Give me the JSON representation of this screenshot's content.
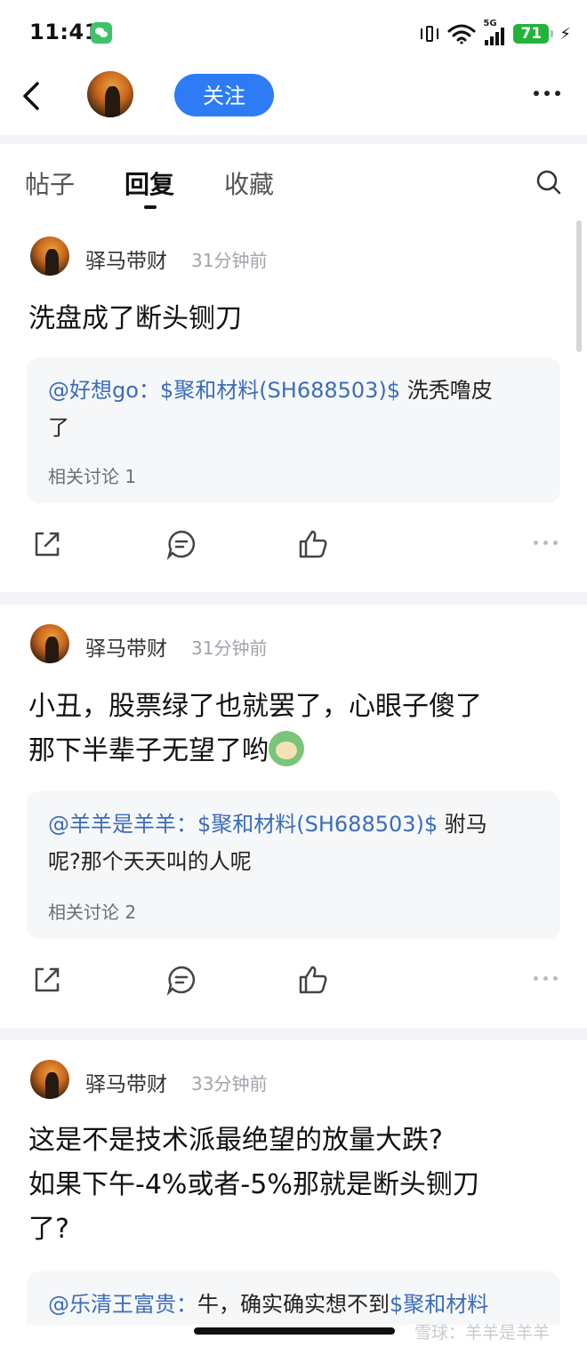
{
  "status": {
    "time": "11:41",
    "network": "5G",
    "battery": "71"
  },
  "header": {
    "follow_label": "关注"
  },
  "tabs": [
    "帖子",
    "回复",
    "收藏"
  ],
  "posts": [
    {
      "author": "驿马带财",
      "time": "31分钟前",
      "content": "洗盘成了断头铡刀",
      "quote": {
        "user": "@好想go：",
        "stock": "$聚和材料(SH688503)$",
        "text_a": " 洗秃噜皮",
        "text_b": "了",
        "meta": "相关讨论 1"
      }
    },
    {
      "author": "驿马带财",
      "time": "31分钟前",
      "content_line1": "小丑，股票绿了也就罢了，心眼子傻了",
      "content_line2": "那下半辈子无望了哟",
      "quote": {
        "user": "@羊羊是羊羊：",
        "stock": "$聚和材料(SH688503)$",
        "text_a": " 驸马",
        "text_b": "呢?那个天天叫的人呢",
        "meta": "相关讨论 2"
      }
    },
    {
      "author": "驿马带财",
      "time": "33分钟前",
      "content_line1": "这是不是技术派最绝望的放量大跌?",
      "content_line2": "如果下午-4%或者-5%那就是断头铡刀",
      "content_line3": "了?",
      "quote": {
        "user": "@乐清王富贵：",
        "text_a": "牛，确实确实想不到",
        "stock": "$聚和材料"
      }
    }
  ],
  "watermark": "雪球：羊羊是羊羊"
}
